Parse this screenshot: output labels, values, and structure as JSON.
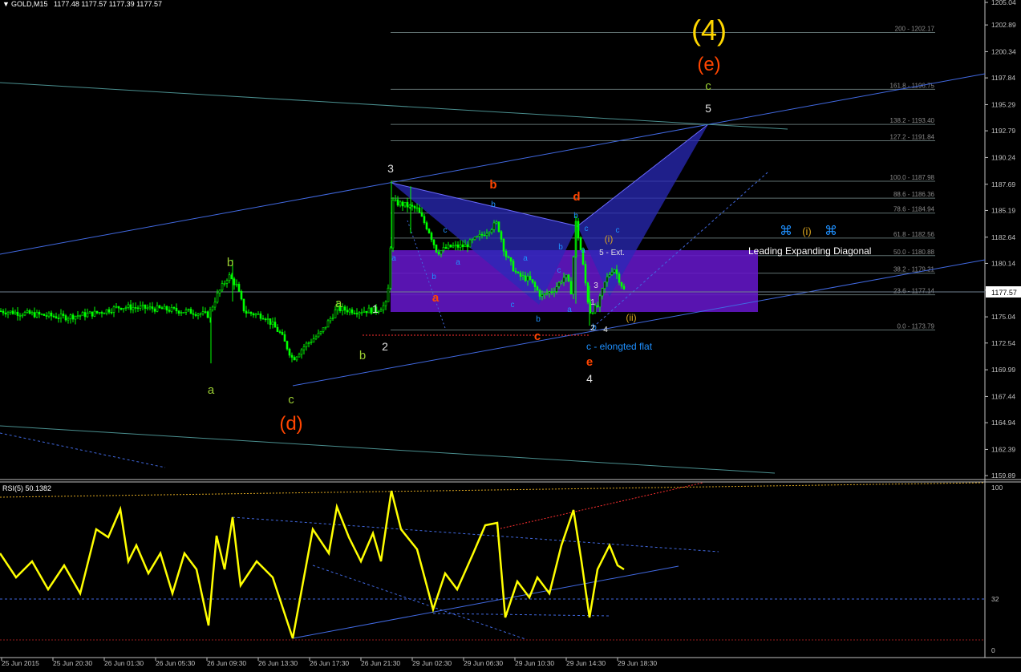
{
  "header": {
    "symbol_label": "GOLD,M15",
    "ohlc": "1177.48 1177.57 1177.39 1177.57",
    "dropdown_glyph": "▼"
  },
  "price_axis": {
    "ticks": [
      "1205.04",
      "1202.89",
      "1200.34",
      "1197.84",
      "1195.29",
      "1192.79",
      "1190.24",
      "1187.69",
      "1185.19",
      "1182.64",
      "1180.14",
      "1177.59",
      "1175.04",
      "1172.54",
      "1169.99",
      "1167.44",
      "1164.94",
      "1162.39",
      "1159.89"
    ],
    "current_price": "1177.57"
  },
  "fib_levels": [
    {
      "label": "200 - 1202.17"
    },
    {
      "label": "161.8 - 1196.75"
    },
    {
      "label": "138.2 - 1193.40"
    },
    {
      "label": "127.2 - 1191.84"
    },
    {
      "label": "100.0 - 1187.98"
    },
    {
      "label": "88.6 - 1186.36"
    },
    {
      "label": "78.6 - 1184.94"
    },
    {
      "label": "61.8 - 1182.56"
    },
    {
      "label": "50.0 - 1180.88"
    },
    {
      "label": "38.2 - 1179.21"
    },
    {
      "label": "23.6 - 1177.14"
    },
    {
      "label": "0.0 - 1173.79"
    }
  ],
  "wave_labels": {
    "w4_big": "(4)",
    "e_paren": "(e)",
    "c_top": "c",
    "five_top": "5",
    "three": "3",
    "b_left": "b",
    "a_left": "a",
    "a_lower": "a",
    "b_lower": "b",
    "c_low": "c",
    "d_paren": "(d)",
    "one": "1",
    "two": "2",
    "red_b": "b",
    "red_a": "a",
    "red_c": "c",
    "red_d": "d",
    "red_e": "e",
    "four": "4",
    "i_paren": "(i)",
    "ii_paren": "(ii)",
    "five_ext": "5 - Ext.",
    "elongated_flat": "c - elongted flat",
    "diagonal_label": "Leading Expanding Diagonal",
    "diag_i": "(i)",
    "cmd_glyph": "⌘",
    "small_blue": [
      "a",
      "b",
      "c",
      "a",
      "b",
      "c",
      "a",
      "b",
      "c",
      "a",
      "b",
      "c",
      "b",
      "a",
      "b",
      "c"
    ],
    "small_numbers": [
      "1",
      "2",
      "3",
      "4"
    ]
  },
  "rsi": {
    "title": "RSI(5) 50.1382",
    "axis": [
      "100",
      "32",
      "0"
    ]
  },
  "time_axis": [
    "25 Jun 2015",
    "25 Jun 20:30",
    "26 Jun 01:30",
    "26 Jun 05:30",
    "26 Jun 09:30",
    "26 Jun 13:30",
    "26 Jun 17:30",
    "26 Jun 21:30",
    "29 Jun 02:30",
    "29 Jun 06:30",
    "29 Jun 10:30",
    "29 Jun 14:30",
    "29 Jun 18:30"
  ],
  "colors": {
    "candle": "#00ff00",
    "rsi_line": "#ffff00",
    "trendline": "#4169e1",
    "fib": "#708090",
    "pattern_fill": "#3030c0",
    "zone_fill": "#5a0fb0",
    "wave_red": "#ff4500",
    "wave_green": "#9acd32",
    "wave_blue": "#1e90ff",
    "wave_gold": "#ffd700"
  }
}
